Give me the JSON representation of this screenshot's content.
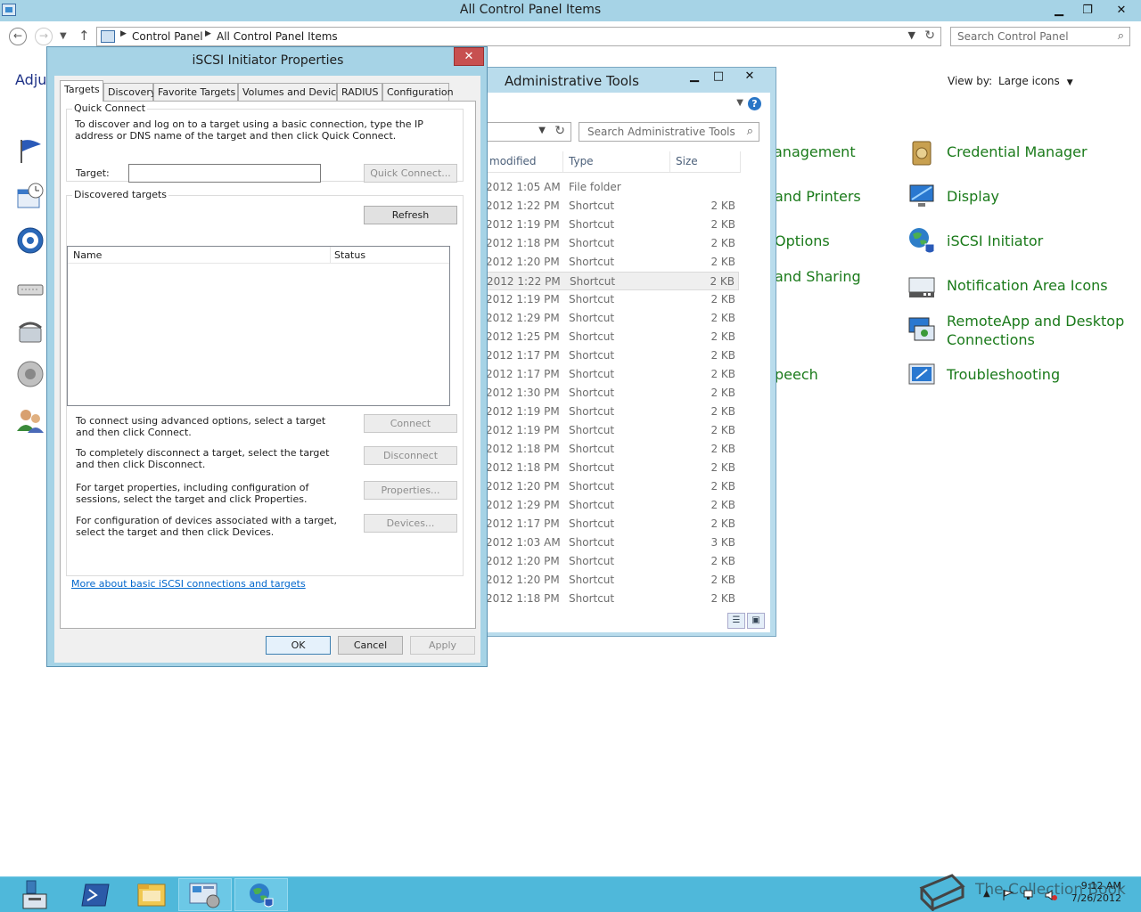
{
  "control_panel": {
    "title": "All Control Panel Items",
    "breadcrumb": [
      "Control Panel",
      "All Control Panel Items"
    ],
    "search_placeholder": "Search Control Panel",
    "heading_partial": "Adjus",
    "view_by_label": "View by:",
    "view_by_value": "Large icons",
    "items_col3": [
      "anagement",
      "and Printers",
      "Options",
      "and Sharing",
      "peech"
    ],
    "items_col4": [
      "Credential Manager",
      "Display",
      "iSCSI Initiator",
      "Notification Area Icons",
      "RemoteApp and Desktop Connections",
      "Troubleshooting"
    ]
  },
  "admin_tools": {
    "title": "Administrative Tools",
    "search_placeholder": "Search Administrative Tools",
    "columns": [
      "modified",
      "Type",
      "Size"
    ],
    "rows": [
      {
        "date": "2012 1:05 AM",
        "type": "File folder",
        "size": ""
      },
      {
        "date": "2012 1:22 PM",
        "type": "Shortcut",
        "size": "2 KB"
      },
      {
        "date": "2012 1:19 PM",
        "type": "Shortcut",
        "size": "2 KB"
      },
      {
        "date": "2012 1:18 PM",
        "type": "Shortcut",
        "size": "2 KB"
      },
      {
        "date": "2012 1:20 PM",
        "type": "Shortcut",
        "size": "2 KB"
      },
      {
        "date": "2012 1:22 PM",
        "type": "Shortcut",
        "size": "2 KB"
      },
      {
        "date": "2012 1:19 PM",
        "type": "Shortcut",
        "size": "2 KB"
      },
      {
        "date": "2012 1:29 PM",
        "type": "Shortcut",
        "size": "2 KB"
      },
      {
        "date": "2012 1:25 PM",
        "type": "Shortcut",
        "size": "2 KB"
      },
      {
        "date": "2012 1:17 PM",
        "type": "Shortcut",
        "size": "2 KB"
      },
      {
        "date": "2012 1:17 PM",
        "type": "Shortcut",
        "size": "2 KB"
      },
      {
        "date": "2012 1:30 PM",
        "type": "Shortcut",
        "size": "2 KB"
      },
      {
        "date": "2012 1:19 PM",
        "type": "Shortcut",
        "size": "2 KB"
      },
      {
        "date": "2012 1:19 PM",
        "type": "Shortcut",
        "size": "2 KB"
      },
      {
        "date": "2012 1:18 PM",
        "type": "Shortcut",
        "size": "2 KB"
      },
      {
        "date": "2012 1:18 PM",
        "type": "Shortcut",
        "size": "2 KB"
      },
      {
        "date": "2012 1:20 PM",
        "type": "Shortcut",
        "size": "2 KB"
      },
      {
        "date": "2012 1:29 PM",
        "type": "Shortcut",
        "size": "2 KB"
      },
      {
        "date": "2012 1:17 PM",
        "type": "Shortcut",
        "size": "2 KB"
      },
      {
        "date": "2012 1:03 AM",
        "type": "Shortcut",
        "size": "3 KB"
      },
      {
        "date": "2012 1:20 PM",
        "type": "Shortcut",
        "size": "2 KB"
      },
      {
        "date": "2012 1:20 PM",
        "type": "Shortcut",
        "size": "2 KB"
      },
      {
        "date": "2012 1:18 PM",
        "type": "Shortcut",
        "size": "2 KB"
      }
    ]
  },
  "iscsi": {
    "title": "iSCSI Initiator Properties",
    "tabs": [
      "Targets",
      "Discovery",
      "Favorite Targets",
      "Volumes and Devices",
      "RADIUS",
      "Configuration"
    ],
    "quick_connect": {
      "group_label": "Quick Connect",
      "description": "To discover and log on to a target using a basic connection, type the IP address or DNS name of the target and then click Quick Connect.",
      "target_label": "Target:",
      "target_value": "",
      "button": "Quick Connect..."
    },
    "discovered": {
      "group_label": "Discovered targets",
      "refresh_button": "Refresh",
      "col_name": "Name",
      "col_status": "Status",
      "actions": [
        {
          "text": "To connect using advanced options, select a target and then click Connect.",
          "button": "Connect"
        },
        {
          "text": "To completely disconnect a target, select the target and then click Disconnect.",
          "button": "Disconnect"
        },
        {
          "text": "For target properties, including configuration of sessions, select the target and click Properties.",
          "button": "Properties..."
        },
        {
          "text": "For configuration of devices associated with a target, select the target and then click Devices.",
          "button": "Devices..."
        }
      ]
    },
    "link": "More about basic iSCSI connections and targets",
    "ok": "OK",
    "cancel": "Cancel",
    "apply": "Apply"
  },
  "taskbar": {
    "time": "9:12 AM",
    "date": "7/26/2012",
    "watermark": "The Collection Book"
  }
}
